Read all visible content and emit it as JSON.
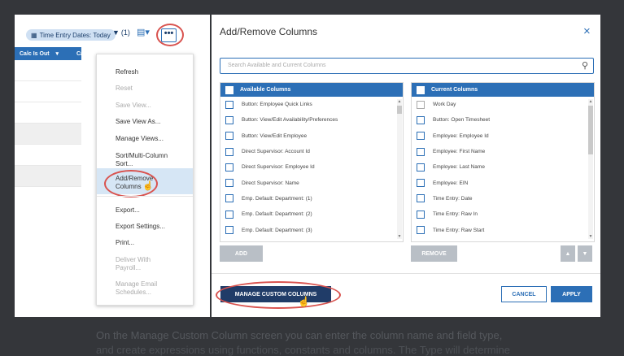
{
  "toolbar": {
    "filter_label": "Time Entry Dates: Today",
    "filter_count": "(1)",
    "more_label": "•••",
    "filter_icon": "calendar-icon",
    "funnel_icon": "funnel-icon",
    "doc_icon": "document-icon"
  },
  "grid": {
    "col1": "Calc Is Out",
    "col2": "Ca"
  },
  "menu": {
    "refresh": "Refresh",
    "reset": "Reset",
    "save_view": "Save View...",
    "save_view_as": "Save View As...",
    "manage_views": "Manage Views...",
    "sort_multi": "Sort/Multi-Column",
    "sort_multi_2": "Sort...",
    "add_remove": "Add/Remove",
    "add_remove_2": "Columns",
    "export": "Export...",
    "export_settings": "Export Settings...",
    "print": "Print...",
    "deliver": "Deliver With",
    "deliver_2": "Payroll...",
    "manage_email": "Manage Email",
    "manage_email_2": "Schedules..."
  },
  "dialog": {
    "title": "Add/Remove Columns",
    "close_icon": "×",
    "search_placeholder": "Search Available and Current Columns",
    "available_header": "Available Columns",
    "current_header": "Current Columns",
    "available": [
      "Button: Employee Quick Links",
      "Button: View/Edit Availability/Preferences",
      "Button: View/Edit Employee",
      "Direct Supervisor: Account Id",
      "Direct Supervisor: Employee Id",
      "Direct Supervisor: Name",
      "Emp. Default: Department: (1)",
      "Emp. Default: Department: (2)",
      "Emp. Default: Department: (3)"
    ],
    "current": [
      "Work Day",
      "Button: Open Timesheet",
      "Employee: Employee Id",
      "Employee: First Name",
      "Employee: Last Name",
      "Employee: EIN",
      "Time Entry: Date",
      "Time Entry: Raw In",
      "Time Entry: Raw Start"
    ],
    "add": "ADD",
    "remove": "REMOVE",
    "up": "▲",
    "down": "▼",
    "manage_custom": "MANAGE CUSTOM COLUMNS",
    "cancel": "CANCEL",
    "apply": "APPLY"
  },
  "background": {
    "caption": "On the Manage Custom Column screen you can enter the column name and field type,",
    "caption_2": "and create expressions using functions, constants and columns. The Type will determine"
  },
  "colors": {
    "accent": "#2c6fb6",
    "dark_button": "#203c68",
    "highlight_ring": "#d9534f"
  }
}
